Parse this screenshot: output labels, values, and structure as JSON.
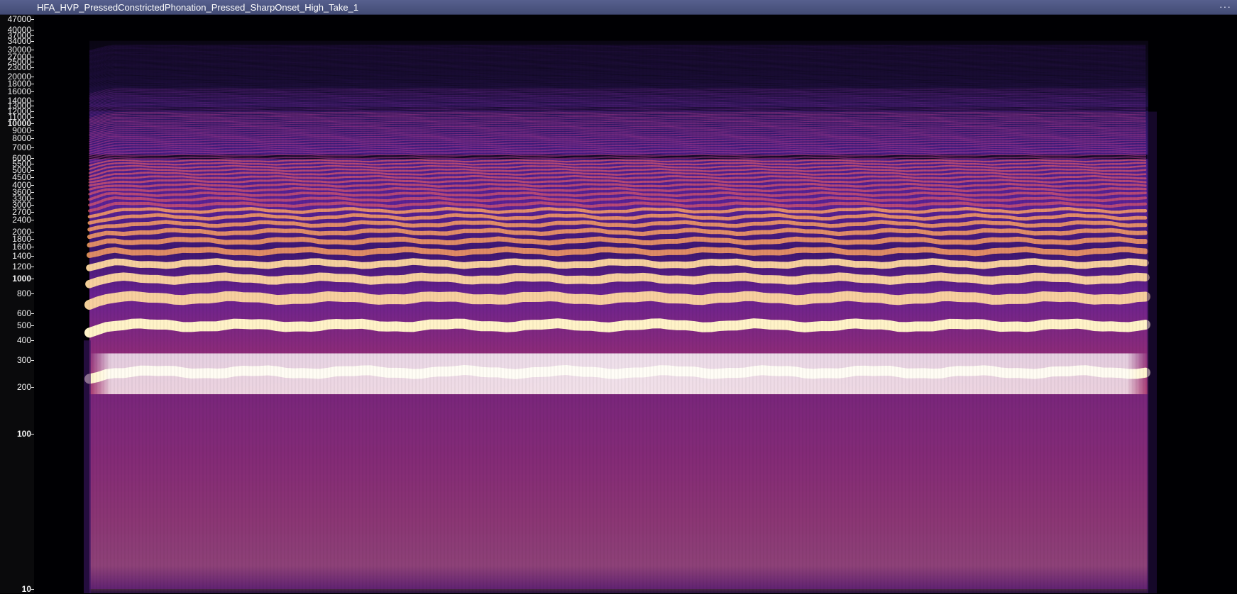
{
  "window": {
    "title": "HFA_HVP_PressedConstrictedPhonation_Pressed_SharpOnset_High_Take_1",
    "more_label": "···"
  },
  "colors": {
    "titlebar": "#4c5582",
    "background": "#000000",
    "colormap": "magma"
  },
  "frequency_axis": {
    "scale": "log",
    "unit": "Hz",
    "range": [
      10,
      48000
    ],
    "ticks": [
      {
        "label": "47000",
        "value": 47000
      },
      {
        "label": "40000",
        "value": 40000
      },
      {
        "label": "37000",
        "value": 37000
      },
      {
        "label": "34000",
        "value": 34000
      },
      {
        "label": "30000",
        "value": 30000
      },
      {
        "label": "27000",
        "value": 27000
      },
      {
        "label": "25000",
        "value": 25000
      },
      {
        "label": "23000",
        "value": 23000
      },
      {
        "label": "20000",
        "value": 20000
      },
      {
        "label": "18000",
        "value": 18000
      },
      {
        "label": "16000",
        "value": 16000
      },
      {
        "label": "14000",
        "value": 14000
      },
      {
        "label": "13000",
        "value": 13000
      },
      {
        "label": "12000",
        "value": 12000
      },
      {
        "label": "11000",
        "value": 11000
      },
      {
        "label": "10000",
        "value": 10000,
        "bold": true
      },
      {
        "label": "9000",
        "value": 9000
      },
      {
        "label": "8000",
        "value": 8000
      },
      {
        "label": "7000",
        "value": 7000
      },
      {
        "label": "6000",
        "value": 6000
      },
      {
        "label": "5500",
        "value": 5500
      },
      {
        "label": "5000",
        "value": 5000
      },
      {
        "label": "4500",
        "value": 4500
      },
      {
        "label": "4000",
        "value": 4000
      },
      {
        "label": "3600",
        "value": 3600
      },
      {
        "label": "3300",
        "value": 3300
      },
      {
        "label": "3000",
        "value": 3000
      },
      {
        "label": "2700",
        "value": 2700
      },
      {
        "label": "2400",
        "value": 2400
      },
      {
        "label": "2000",
        "value": 2000
      },
      {
        "label": "1800",
        "value": 1800
      },
      {
        "label": "1600",
        "value": 1600
      },
      {
        "label": "1400",
        "value": 1400
      },
      {
        "label": "1200",
        "value": 1200
      },
      {
        "label": "1000",
        "value": 1000,
        "bold": true
      },
      {
        "label": "800",
        "value": 800
      },
      {
        "label": "600",
        "value": 600
      },
      {
        "label": "500",
        "value": 500
      },
      {
        "label": "400",
        "value": 400
      },
      {
        "label": "300",
        "value": 300
      },
      {
        "label": "200",
        "value": 200
      },
      {
        "label": "100",
        "value": 100,
        "bold": true
      },
      {
        "label": "10",
        "value": 10,
        "bold": true
      }
    ]
  },
  "spectrogram": {
    "fundamental_hz": 250,
    "harmonic_upper_limit_hz": 32000,
    "sound_onset_fraction": 0.046,
    "sound_offset_fraction": 0.926
  }
}
